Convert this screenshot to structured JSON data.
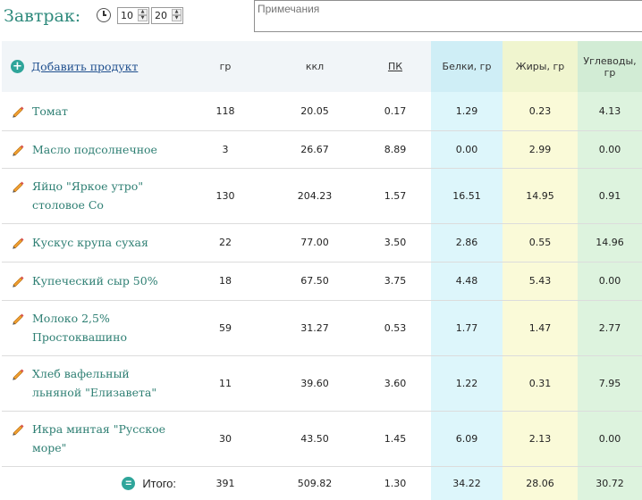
{
  "header": {
    "meal_title": "Завтрак:",
    "time_hours": "10",
    "time_minutes": "20",
    "notes_placeholder": "Примечания"
  },
  "table": {
    "columns": {
      "add_product": "Добавить продукт",
      "grams": "гр",
      "kcal": "ккл",
      "gi": "ПК",
      "protein": "Белки, гр",
      "fat": "Жиры, гр",
      "carbs": "Углеводы, гр"
    },
    "rows": [
      {
        "name": "Томат",
        "grams": "118",
        "kcal": "20.05",
        "gi": "0.17",
        "protein": "1.29",
        "fat": "0.23",
        "carbs": "4.13"
      },
      {
        "name": "Масло подсолнечное",
        "grams": "3",
        "kcal": "26.67",
        "gi": "8.89",
        "protein": "0.00",
        "fat": "2.99",
        "carbs": "0.00"
      },
      {
        "name": "Яйцо \"Яркое утро\" столовое Со",
        "grams": "130",
        "kcal": "204.23",
        "gi": "1.57",
        "protein": "16.51",
        "fat": "14.95",
        "carbs": "0.91"
      },
      {
        "name": "Кускус крупа сухая",
        "grams": "22",
        "kcal": "77.00",
        "gi": "3.50",
        "protein": "2.86",
        "fat": "0.55",
        "carbs": "14.96"
      },
      {
        "name": "Купеческий сыр 50%",
        "grams": "18",
        "kcal": "67.50",
        "gi": "3.75",
        "protein": "4.48",
        "fat": "5.43",
        "carbs": "0.00"
      },
      {
        "name": "Молоко 2,5% Простоквашино",
        "grams": "59",
        "kcal": "31.27",
        "gi": "0.53",
        "protein": "1.77",
        "fat": "1.47",
        "carbs": "2.77"
      },
      {
        "name": "Хлеб вафельный льняной \"Елизавета\"",
        "grams": "11",
        "kcal": "39.60",
        "gi": "3.60",
        "protein": "1.22",
        "fat": "0.31",
        "carbs": "7.95"
      },
      {
        "name": "Икра минтая \"Русское море\"",
        "grams": "30",
        "kcal": "43.50",
        "gi": "1.45",
        "protein": "6.09",
        "fat": "2.13",
        "carbs": "0.00"
      }
    ],
    "totals": {
      "label": "Итого:",
      "grams": "391",
      "kcal": "509.82",
      "gi": "1.30",
      "protein": "34.22",
      "fat": "28.06",
      "carbs": "30.72"
    }
  },
  "colors": {
    "accent": "#2e8a7c",
    "link": "#1f4f8e",
    "protein_bg": "#ddf6fb",
    "fat_bg": "#fafad8",
    "carbs_bg": "#ddf3de"
  },
  "icons": [
    "clock-icon",
    "spinner-up-icon",
    "spinner-down-icon",
    "add-circle-icon",
    "pencil-icon",
    "equals-circle-icon"
  ]
}
